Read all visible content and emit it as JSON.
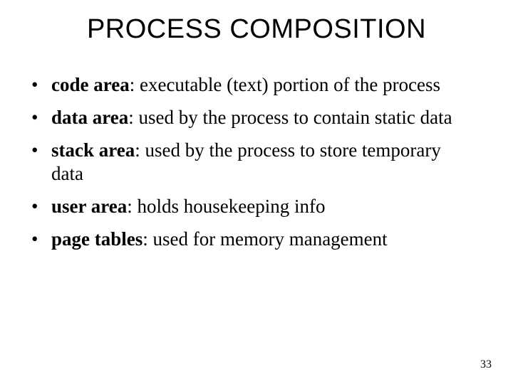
{
  "title": "PROCESS COMPOSITION",
  "bullets": [
    {
      "term": "code area",
      "desc": ": executable (text) portion of the process"
    },
    {
      "term": "data area",
      "desc": ": used by the process to contain static data"
    },
    {
      "term": "stack area",
      "desc": ": used by the process to store temporary data"
    },
    {
      "term": "user area",
      "desc": ": holds housekeeping info"
    },
    {
      "term": "page tables",
      "desc": ": used for memory management"
    }
  ],
  "page_number": "33"
}
